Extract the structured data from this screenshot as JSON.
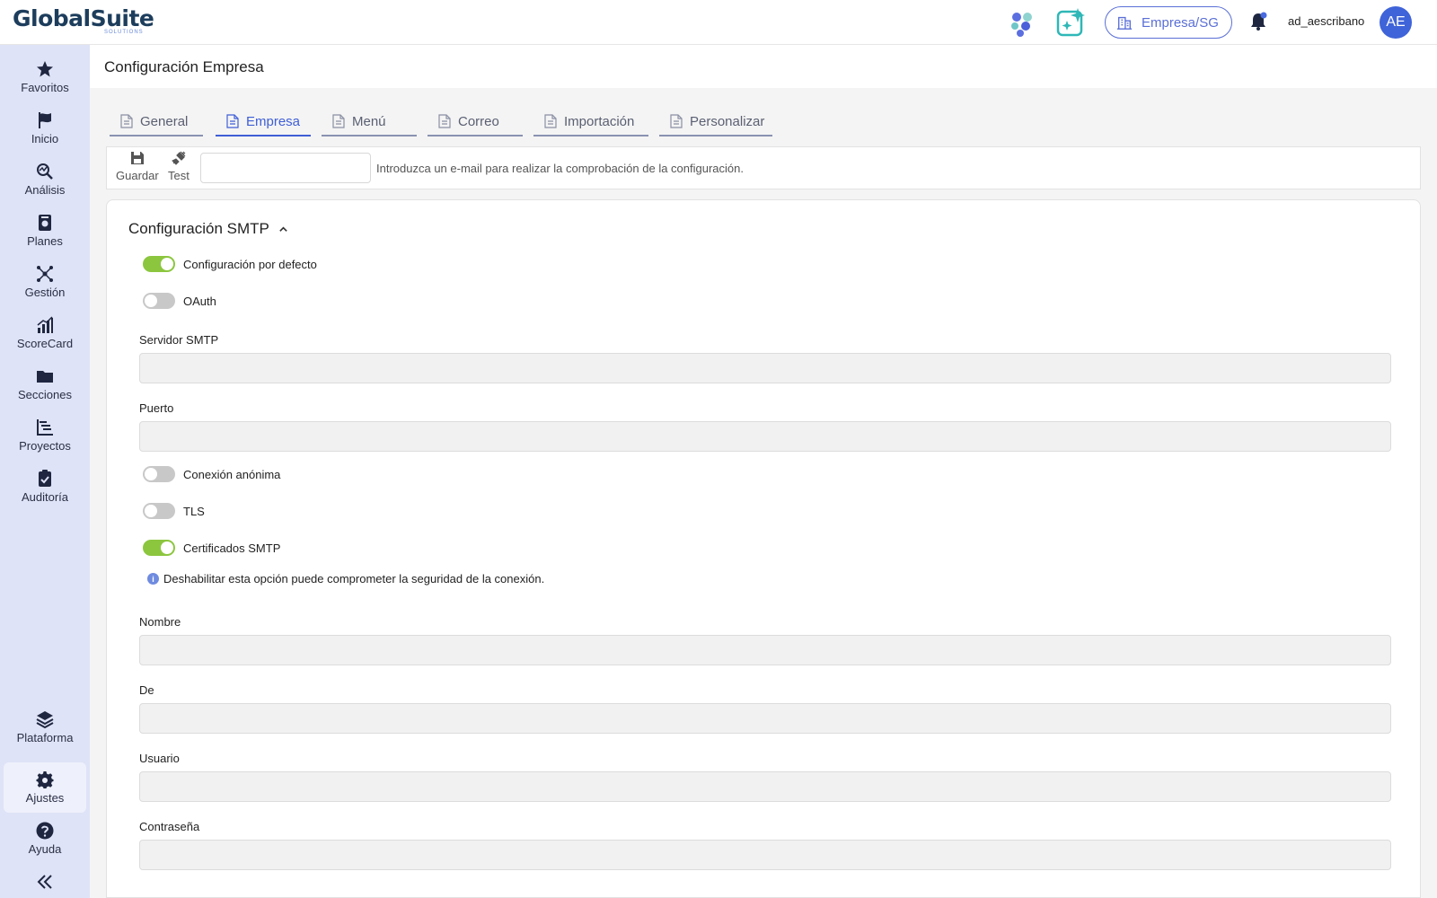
{
  "header": {
    "logo_text": "GlobalSuite",
    "logo_subtext": "SOLUTIONS",
    "company_button": "Empresa/SG",
    "username": "ad_aescribano",
    "avatar_initials": "AE"
  },
  "sidebar": {
    "items": [
      {
        "label": "Favoritos",
        "icon": "star-icon"
      },
      {
        "label": "Inicio",
        "icon": "flag-icon"
      },
      {
        "label": "Análisis",
        "icon": "analysis-icon"
      },
      {
        "label": "Planes",
        "icon": "plans-icon"
      },
      {
        "label": "Gestión",
        "icon": "network-icon"
      },
      {
        "label": "ScoreCard",
        "icon": "bar-chart-icon"
      },
      {
        "label": "Secciones",
        "icon": "folder-icon"
      },
      {
        "label": "Proyectos",
        "icon": "gantt-icon"
      },
      {
        "label": "Auditoría",
        "icon": "clipboard-check-icon"
      }
    ],
    "bottom_items": [
      {
        "label": "Plataforma",
        "icon": "layers-icon"
      },
      {
        "label": "Ajustes",
        "icon": "gear-icon"
      },
      {
        "label": "Ayuda",
        "icon": "help-icon"
      }
    ],
    "active": "Ajustes"
  },
  "page": {
    "title": "Configuración Empresa"
  },
  "tabs": [
    {
      "label": "General"
    },
    {
      "label": "Empresa"
    },
    {
      "label": "Menú"
    },
    {
      "label": "Correo"
    },
    {
      "label": "Importación"
    },
    {
      "label": "Personalizar"
    }
  ],
  "active_tab": "Empresa",
  "toolbar": {
    "save_label": "Guardar",
    "test_label": "Test",
    "test_email_value": "",
    "test_hint": "Introduzca un e-mail para realizar la comprobación de la configuración."
  },
  "smtp": {
    "section_title": "Configuración SMTP",
    "toggles": {
      "default_config": {
        "label": "Configuración por defecto",
        "on": true
      },
      "oauth": {
        "label": "OAuth",
        "on": false
      },
      "anonymous": {
        "label": "Conexión anónima",
        "on": false
      },
      "tls": {
        "label": "TLS",
        "on": false
      },
      "certificates": {
        "label": "Certificados SMTP",
        "on": true
      }
    },
    "info_text": "Deshabilitar esta opción puede comprometer la seguridad de la conexión.",
    "fields": {
      "server": {
        "label": "Servidor SMTP",
        "value": ""
      },
      "port": {
        "label": "Puerto",
        "value": ""
      },
      "name": {
        "label": "Nombre",
        "value": ""
      },
      "from": {
        "label": "De",
        "value": ""
      },
      "user": {
        "label": "Usuario",
        "value": ""
      },
      "password": {
        "label": "Contraseña",
        "value": ""
      }
    }
  },
  "colors": {
    "accent": "#3f5ed6",
    "sidebar_bg": "#dfe3f7",
    "toggle_on": "#8cc63f",
    "avatar_bg": "#3f63d8"
  }
}
